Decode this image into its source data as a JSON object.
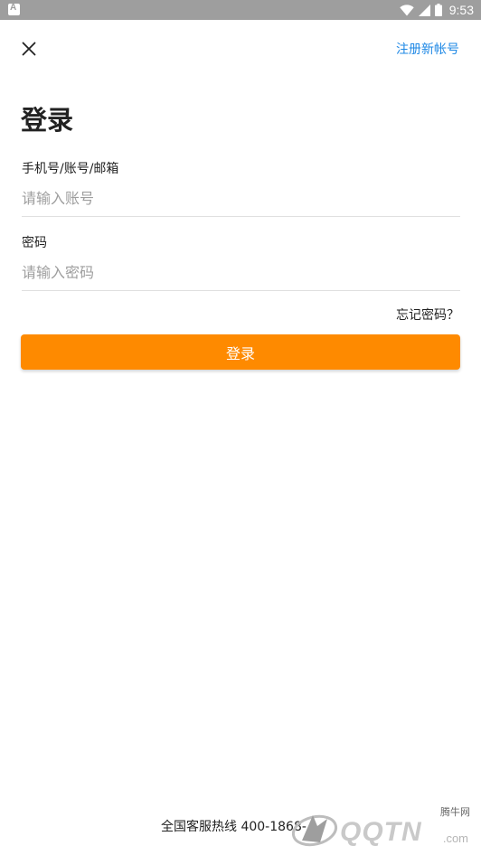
{
  "status_bar": {
    "time": "9:53",
    "icons": [
      "app-notification-icon",
      "wifi-icon",
      "signal-icon",
      "battery-icon"
    ]
  },
  "header": {
    "close_icon": "close-icon",
    "register_label": "注册新帐号"
  },
  "title": "登录",
  "form": {
    "account_label": "手机号/账号/邮箱",
    "account_placeholder": "请输入账号",
    "account_value": "",
    "password_label": "密码",
    "password_placeholder": "请输入密码",
    "password_value": "",
    "forgot_label": "忘记密码？",
    "submit_label": "登录"
  },
  "footer": {
    "hotline": "全国客服热线 400-1868-"
  },
  "watermark": {
    "site_cn": "腾牛网",
    "logo": "QQTN",
    "domain": ".com"
  },
  "colors": {
    "accent": "#fe8a00",
    "link": "#1e88e5",
    "status_bar": "#9e9e9e"
  }
}
